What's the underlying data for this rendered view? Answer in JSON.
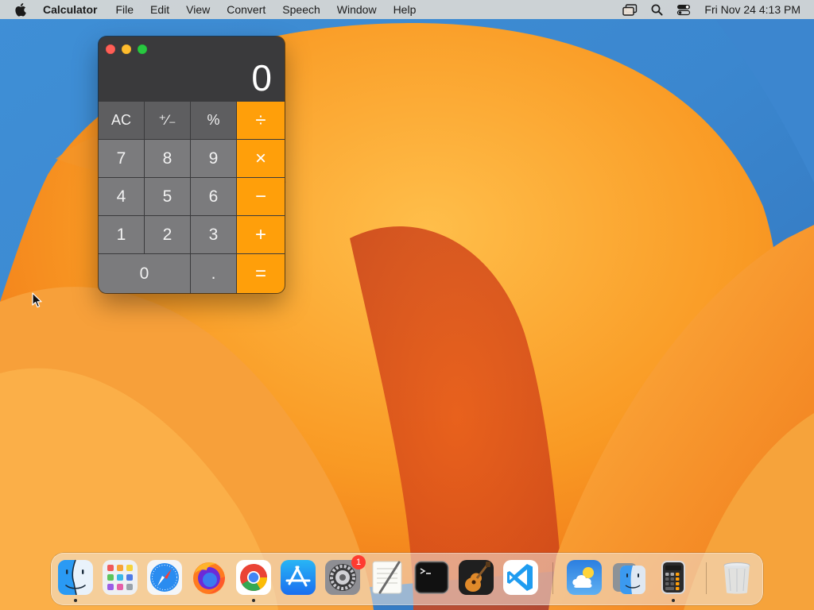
{
  "menubar": {
    "app_name": "Calculator",
    "menus": [
      "File",
      "Edit",
      "View",
      "Convert",
      "Speech",
      "Window",
      "Help"
    ],
    "clock": "Fri Nov 24  4:13 PM",
    "status_icons": [
      "screen-mirroring-icon",
      "spotlight-search-icon",
      "control-center-icon"
    ]
  },
  "calculator": {
    "display": "0",
    "keys": [
      {
        "label": "AC",
        "kind": "fn"
      },
      {
        "label": "⁺∕₋",
        "kind": "fn"
      },
      {
        "label": "%",
        "kind": "fn"
      },
      {
        "label": "÷",
        "kind": "op"
      },
      {
        "label": "7",
        "kind": "num"
      },
      {
        "label": "8",
        "kind": "num"
      },
      {
        "label": "9",
        "kind": "num"
      },
      {
        "label": "×",
        "kind": "op"
      },
      {
        "label": "4",
        "kind": "num"
      },
      {
        "label": "5",
        "kind": "num"
      },
      {
        "label": "6",
        "kind": "num"
      },
      {
        "label": "−",
        "kind": "op"
      },
      {
        "label": "1",
        "kind": "num"
      },
      {
        "label": "2",
        "kind": "num"
      },
      {
        "label": "3",
        "kind": "num"
      },
      {
        "label": "+",
        "kind": "op"
      },
      {
        "label": "0",
        "kind": "num"
      },
      {
        "label": ".",
        "kind": "num"
      },
      {
        "label": "=",
        "kind": "op"
      }
    ],
    "colors": {
      "operator": "#ff9f0a",
      "function": "#5e5e60",
      "number": "#7b7b7d"
    }
  },
  "dock": {
    "apps": [
      {
        "name": "Finder",
        "icon": "finder-icon",
        "running": true
      },
      {
        "name": "Launchpad",
        "icon": "launchpad-icon",
        "running": false
      },
      {
        "name": "Safari",
        "icon": "safari-icon",
        "running": false
      },
      {
        "name": "Firefox",
        "icon": "firefox-icon",
        "running": false
      },
      {
        "name": "Google Chrome",
        "icon": "chrome-icon",
        "running": true
      },
      {
        "name": "App Store",
        "icon": "app-store-icon",
        "running": false
      },
      {
        "name": "System Settings",
        "icon": "system-settings-icon",
        "running": false,
        "badge": "1"
      },
      {
        "name": "TextEdit",
        "icon": "textedit-icon",
        "running": false
      },
      {
        "name": "Terminal",
        "icon": "terminal-icon",
        "running": false
      },
      {
        "name": "GarageBand",
        "icon": "garageband-icon",
        "running": false
      },
      {
        "name": "Visual Studio Code",
        "icon": "vscode-icon",
        "running": false
      },
      {
        "name": "Weather",
        "icon": "weather-icon",
        "running": false
      },
      {
        "name": "Migration Assistant",
        "icon": "migration-assistant-icon",
        "running": false
      },
      {
        "name": "Calculator",
        "icon": "calculator-icon",
        "running": true
      },
      {
        "name": "Trash",
        "icon": "trash-icon",
        "running": false
      }
    ]
  }
}
